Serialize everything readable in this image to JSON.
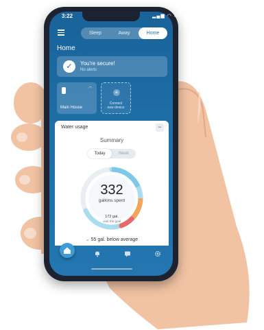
{
  "status_bar": {
    "time": "3:22",
    "icons": "▂▄▆ ◠ ▭"
  },
  "mode_switch": {
    "options": [
      "Sleep",
      "Away",
      "Home"
    ],
    "selected": "Home"
  },
  "page_title": "Home",
  "security": {
    "title": "You're secure!",
    "subtitle": "No alerts"
  },
  "devices": {
    "main_house": "Main House",
    "connect_label_line1": "Connect",
    "connect_label_line2": "new device"
  },
  "water_usage": {
    "title": "Water usage",
    "summary_title": "Summary",
    "periods": [
      "Today",
      "Week"
    ],
    "selected_period": "Today",
    "value": "332",
    "unit": "gallons spent",
    "goal_value": "172 gal.",
    "goal_label": "over the goal",
    "below_average": "55 gal. below average"
  },
  "nav": {
    "items": [
      "home",
      "alerts",
      "messages",
      "settings"
    ]
  },
  "colors": {
    "primary": "#1e6fa8",
    "accent": "#3e9bd8",
    "gauge_light": "#a9dcef",
    "gauge_orange": "#f2a65a",
    "gauge_red": "#e66a6a"
  }
}
